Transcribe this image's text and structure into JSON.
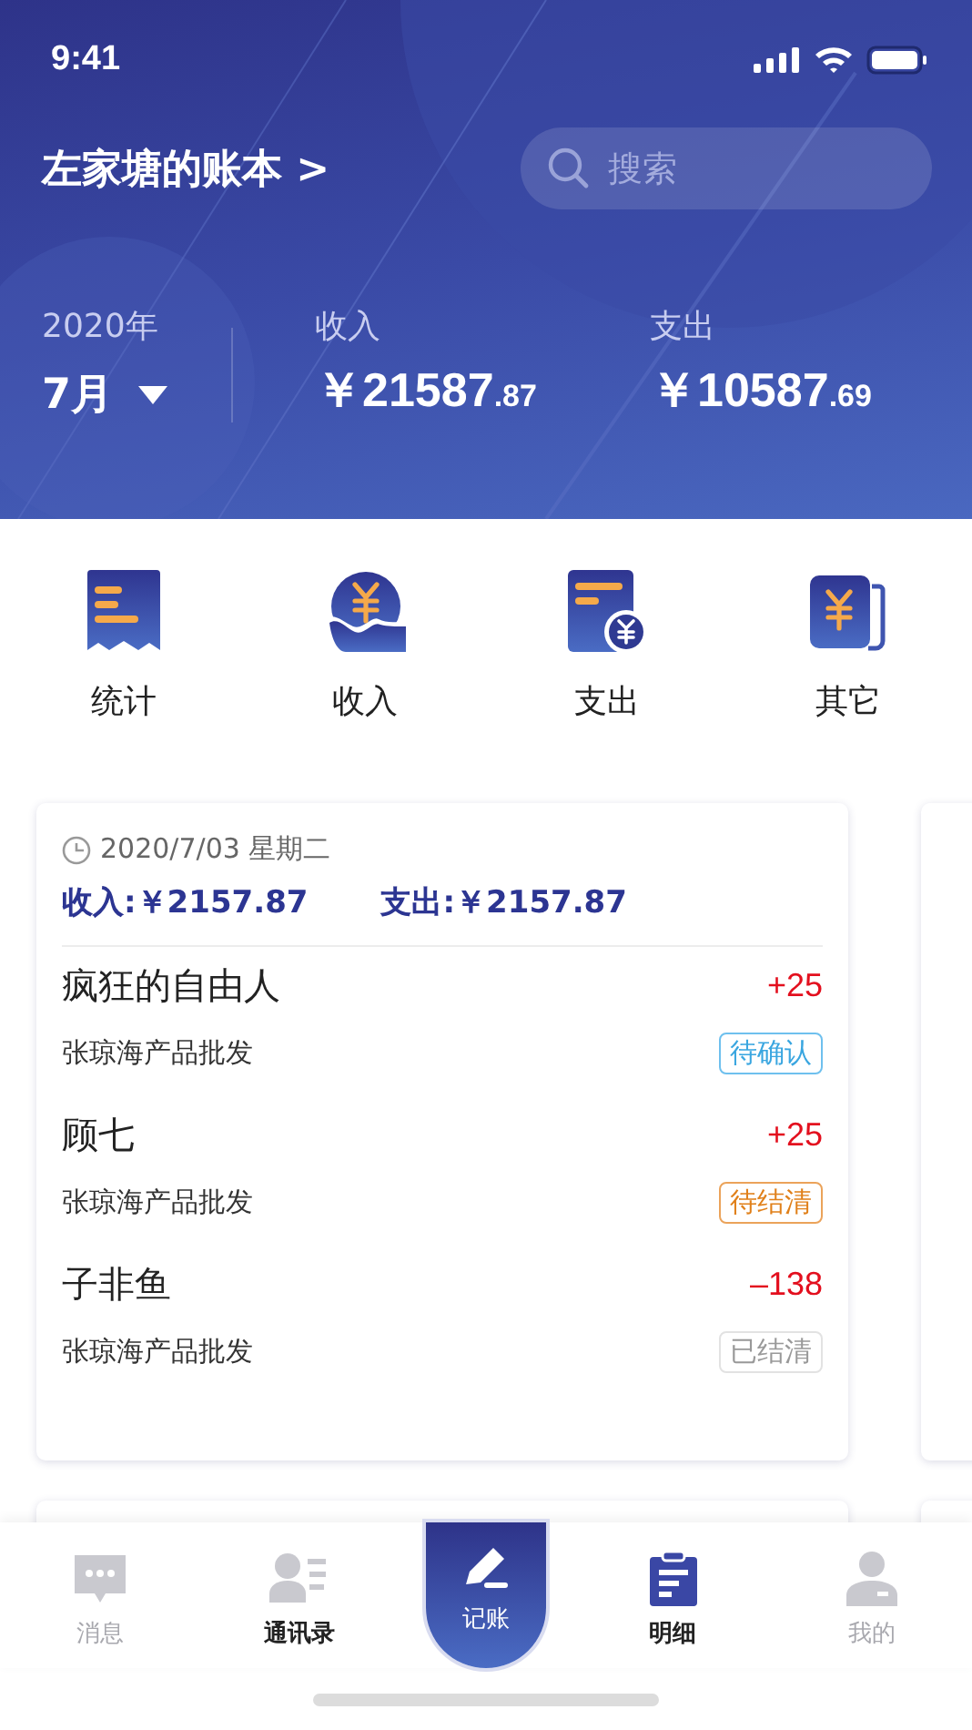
{
  "status_bar": {
    "time": "9:41"
  },
  "header": {
    "book_title": "左家塘的账本 >",
    "search": {
      "placeholder": "搜索"
    },
    "year": "2020年",
    "month": "7月",
    "income": {
      "label": "收入",
      "currency": "￥",
      "integer": "21587",
      "decimal": ".87"
    },
    "expense": {
      "label": "支出",
      "currency": "￥",
      "integer": "10587",
      "decimal": ".69"
    }
  },
  "quick_actions": [
    {
      "kind": "stats",
      "label": "统计"
    },
    {
      "kind": "income",
      "label": "收入"
    },
    {
      "kind": "expense",
      "label": "支出"
    },
    {
      "kind": "other",
      "label": "其它"
    }
  ],
  "day_card": {
    "date": "2020/7/03 星期二",
    "income": "收入:￥2157.87",
    "expense": "支出:￥2157.87",
    "entries": [
      {
        "name": "疯狂的自由人",
        "amount": "+25",
        "company": "张琼海产品批发",
        "status": "待确认",
        "kind": "pending_confirm"
      },
      {
        "name": "顾七",
        "amount": "+25",
        "company": "张琼海产品批发",
        "status": "待结清",
        "kind": "pending_settle"
      },
      {
        "name": "子非鱼",
        "amount": "–138",
        "company": "张琼海产品批发",
        "status": "已结清",
        "kind": "settled"
      }
    ]
  },
  "tab_bar": [
    {
      "kind": "messages",
      "label": "消息",
      "selected": false,
      "strong": false
    },
    {
      "kind": "contacts",
      "label": "通讯录",
      "selected": false,
      "strong": true
    },
    {
      "kind": "record",
      "label": "记账",
      "selected": false
    },
    {
      "kind": "details",
      "label": "明细",
      "selected": true,
      "strong": true
    },
    {
      "kind": "me",
      "label": "我的",
      "selected": false,
      "strong": false
    }
  ]
}
